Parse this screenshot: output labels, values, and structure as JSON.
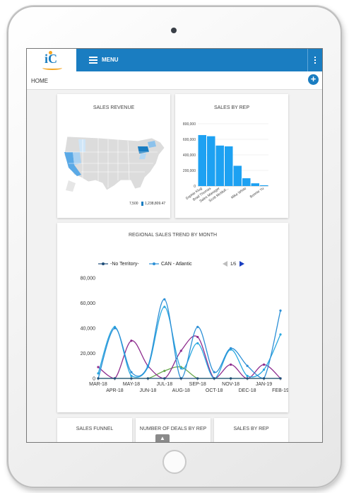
{
  "app": {
    "menu_label": "MENU",
    "breadcrumb": "HOME",
    "logo_text": "iC",
    "add_icon": "plus-icon",
    "colors": {
      "header": "#1a7dc1",
      "accent": "#1a7dc1",
      "logo_accent": "#f5a623"
    }
  },
  "cards": {
    "sales_revenue": {
      "title": "SALES REVENUE",
      "legend_min": "7,500",
      "legend_max": "1,238,809.47"
    },
    "sales_by_rep": {
      "title": "SALES BY REP"
    },
    "regional_trend": {
      "title": "REGIONAL SALES TREND BY MONTH",
      "legend_page": "1/5"
    },
    "bottom": {
      "sales_funnel": "SALES FUNNEL",
      "deals_by_rep": "NUMBER OF DEALS BY REP",
      "sales_by_rep_2": "SALES BY REP"
    }
  },
  "chart_data": [
    {
      "type": "bar",
      "title": "SALES BY REP",
      "categories": [
        "Sophie Klug",
        "Brad Thomas",
        "Sales Manager",
        "Scott McMull...",
        "",
        "Mike White",
        "",
        "Bonnie Yu"
      ],
      "values": [
        655000,
        640000,
        520000,
        510000,
        260000,
        100000,
        35000,
        10000
      ],
      "ylim": [
        0,
        800000
      ],
      "yticks": [
        "0",
        "200,000",
        "400,000",
        "600,000",
        "800,000"
      ],
      "xlabel": "",
      "ylabel": ""
    },
    {
      "type": "line",
      "title": "REGIONAL SALES TREND BY MONTH",
      "categories": [
        "MAR-18",
        "APR-18",
        "MAY-18",
        "JUN-18",
        "JUL-18",
        "AUG-18",
        "SEP-18",
        "OCT-18",
        "NOV-18",
        "DEC-18",
        "JAN-19",
        "FEB-19"
      ],
      "yticks": [
        "0",
        "20,000",
        "40,000",
        "60,000",
        "80,000"
      ],
      "ylim": [
        0,
        80000
      ],
      "series": [
        {
          "name": "-No Territory-",
          "color": "#1f4e79",
          "values": [
            0,
            0,
            0,
            0,
            0,
            0,
            0,
            0,
            0,
            0,
            0,
            0
          ]
        },
        {
          "name": "CAN - Atlantic",
          "color": "#2b8fd6",
          "values": [
            0,
            40000,
            5000,
            10000,
            63000,
            0,
            41000,
            5000,
            24000,
            10000,
            0,
            54000
          ]
        },
        {
          "name": "",
          "color": "#29a8e0",
          "values": [
            4000,
            41000,
            2000,
            9000,
            57000,
            8000,
            28000,
            0,
            23000,
            2000,
            7000,
            35000
          ]
        },
        {
          "name": "",
          "color": "#8e2c8e",
          "values": [
            9000,
            0,
            30000,
            10000,
            0,
            22000,
            33000,
            0,
            11000,
            0,
            11000,
            0
          ]
        },
        {
          "name": "",
          "color": "#6aa84f",
          "values": [
            0,
            0,
            0,
            0,
            6000,
            9000,
            0,
            0,
            0,
            0,
            0,
            0
          ]
        }
      ]
    }
  ]
}
